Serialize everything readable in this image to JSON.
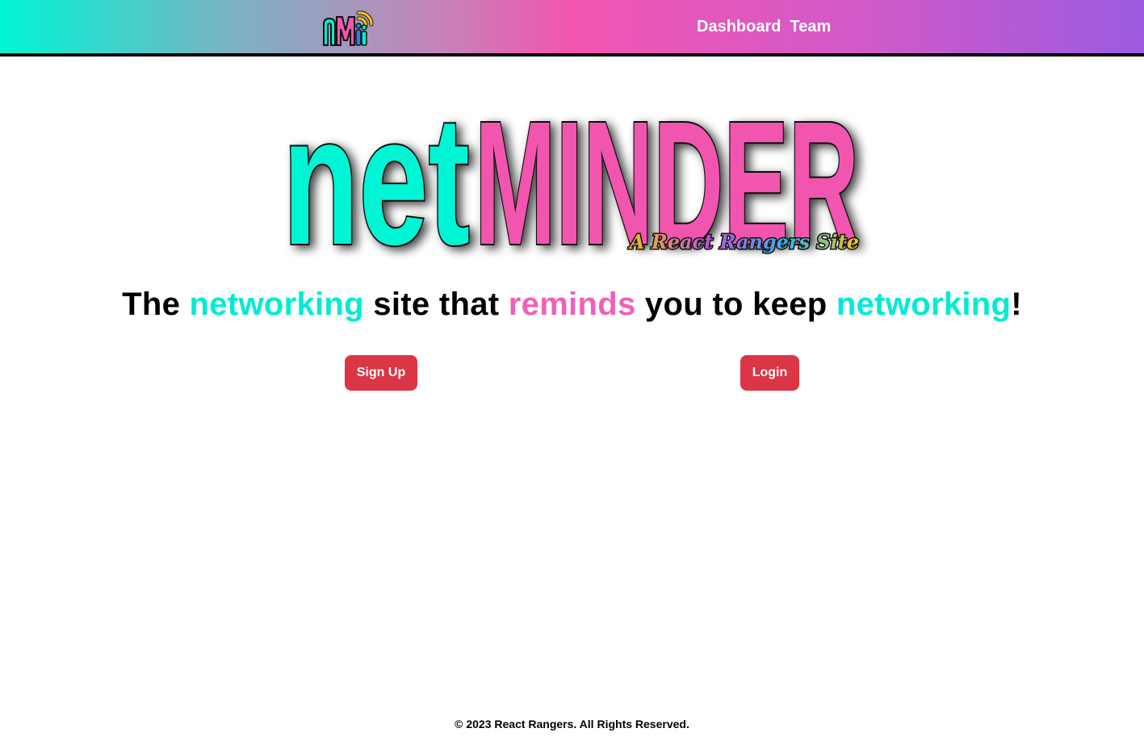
{
  "navbar": {
    "logo_icon": "nm-logo-icon",
    "logo_text": "nM",
    "links": [
      {
        "label": "Dashboard"
      },
      {
        "label": "Team"
      }
    ]
  },
  "hero": {
    "logo_part1": "net",
    "logo_part2": "MINDER",
    "logo_subtitle": "A React Rangers Site",
    "tagline": {
      "w1": "The ",
      "w2": "networking",
      "w3": " site that ",
      "w4": "reminds",
      "w5": " you to keep ",
      "w6": "networking",
      "w7": "!"
    }
  },
  "buttons": {
    "signup_label": "Sign Up",
    "login_label": "Login"
  },
  "footer": {
    "text": "© 2023 React Rangers. All Rights Reserved."
  },
  "colors": {
    "teal": "#00f5d4",
    "pink": "#f255b0",
    "purple": "#9b5be0",
    "button_red": "#dc3545"
  }
}
